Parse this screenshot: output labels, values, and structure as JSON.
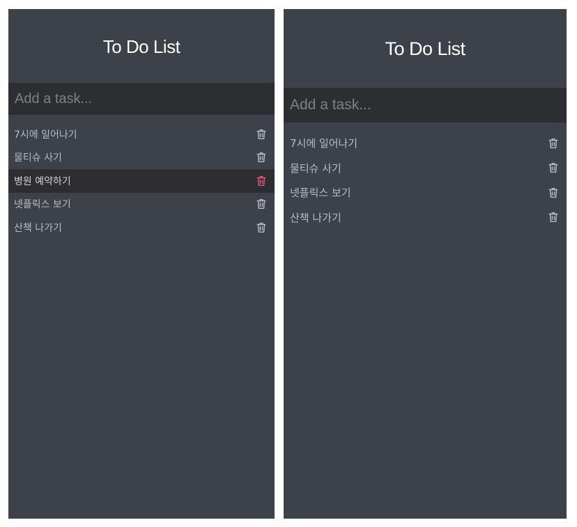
{
  "screens": [
    {
      "title": "To Do List",
      "input": {
        "placeholder": "Add a task..."
      },
      "tasks": [
        {
          "label": "7시에 일어나기"
        },
        {
          "label": "물티슈 사기"
        },
        {
          "label": "병원 예약하기"
        },
        {
          "label": "넷플릭스 보기"
        },
        {
          "label": "산책 나가기"
        }
      ],
      "highlighted_task": "병원 예약하기"
    },
    {
      "title": "To Do List",
      "input": {
        "placeholder": "Add a task..."
      },
      "tasks": [
        {
          "label": "7시에 일어나기"
        },
        {
          "label": "물티슈 사기"
        },
        {
          "label": "넷플릭스 보기"
        },
        {
          "label": "산책 나가기"
        }
      ]
    }
  ],
  "colors": {
    "page_background": "#ffffff",
    "panel_background": "#3d4149",
    "input_background": "#2d2e32",
    "title_text": "#ffffff",
    "item_text": "#b9bcc2",
    "placeholder_text": "#7e8087",
    "highlight_background": "#2d2e32",
    "delete_hover": "#e8557a"
  },
  "icons": {
    "delete": "trash-icon"
  }
}
